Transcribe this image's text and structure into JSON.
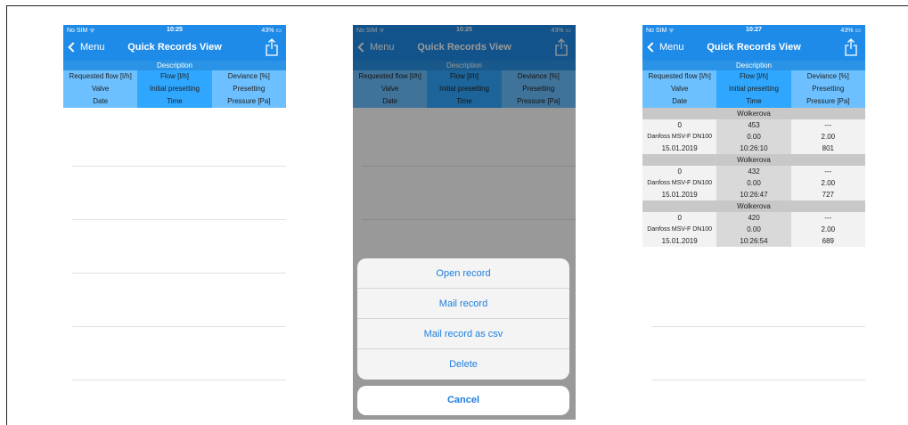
{
  "screens": [
    {
      "status": {
        "carrier": "No SIM ᯤ",
        "time": "10:25",
        "battery": "43% ▭"
      },
      "nav": {
        "back_label": "Menu",
        "title": "Quick Records View"
      },
      "header": {
        "description": "Description",
        "rows": [
          [
            "Requested flow [l/h]",
            "Flow [l/h]",
            "Deviance [%]"
          ],
          [
            "Valve",
            "Initial presetting",
            "Presetting"
          ],
          [
            "Date",
            "Time",
            "Pressure [Pa]"
          ]
        ]
      }
    },
    {
      "status": {
        "carrier": "No SIM ᯤ",
        "time": "10:25",
        "battery": "43% ▭"
      },
      "nav": {
        "back_label": "Menu",
        "title": "Quick Records View"
      },
      "header": {
        "description": "Description",
        "rows": [
          [
            "Requested flow [l/h]",
            "Flow [l/h]",
            "Deviance [%]"
          ],
          [
            "Valve",
            "Initial presetting",
            "Presetting"
          ],
          [
            "Date",
            "Time",
            "Pressure [Pa]"
          ]
        ]
      },
      "action_sheet": {
        "items": [
          "Open record",
          "Mail record",
          "Mail record as csv",
          "Delete"
        ],
        "cancel": "Cancel"
      }
    },
    {
      "status": {
        "carrier": "No SIM ᯤ",
        "time": "10:27",
        "battery": "43% ▭"
      },
      "nav": {
        "back_label": "Menu",
        "title": "Quick Records View"
      },
      "header": {
        "description": "Description",
        "rows": [
          [
            "Requested flow [l/h]",
            "Flow [l/h]",
            "Deviance [%]"
          ],
          [
            "Valve",
            "Initial presetting",
            "Presetting"
          ],
          [
            "Date",
            "Time",
            "Pressure [Pa]"
          ]
        ]
      },
      "records": [
        {
          "title": "Wolkerova",
          "rows": [
            [
              "0",
              "453",
              "---"
            ],
            [
              "Danfoss MSV-F DN100",
              "0.00",
              "2.00"
            ],
            [
              "15.01.2019",
              "10:26:10",
              "801"
            ]
          ]
        },
        {
          "title": "Wolkerova",
          "rows": [
            [
              "0",
              "432",
              "---"
            ],
            [
              "Danfoss MSV-F DN100",
              "0.00",
              "2.00"
            ],
            [
              "15.01.2019",
              "10:26:47",
              "727"
            ]
          ]
        },
        {
          "title": "Wolkerova",
          "rows": [
            [
              "0",
              "420",
              "---"
            ],
            [
              "Danfoss MSV-F DN100",
              "0.00",
              "2.00"
            ],
            [
              "15.01.2019",
              "10:26:54",
              "689"
            ]
          ]
        }
      ]
    }
  ]
}
